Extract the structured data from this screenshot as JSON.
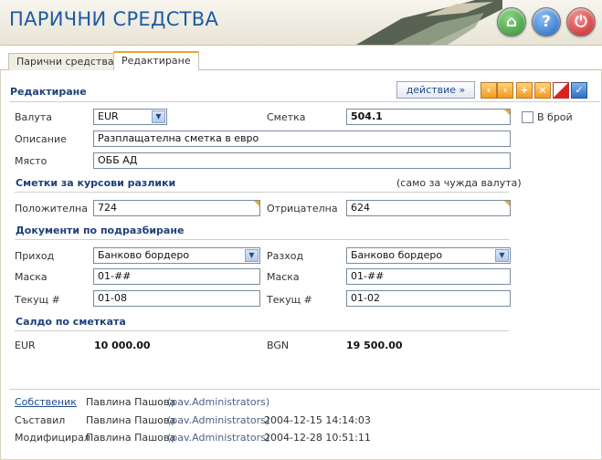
{
  "header": {
    "title": "ПАРИЧНИ СРЕДСТВА"
  },
  "tabs": [
    {
      "label": "Парични средства"
    },
    {
      "label": "Редактиране"
    }
  ],
  "form": {
    "section_title": "Редактиране",
    "action_label": "действие »",
    "currency_label": "Валута",
    "currency_value": "EUR",
    "account_label": "Сметка",
    "account_value": "504.1",
    "in_cash_label": "В брой",
    "description_label": "Описание",
    "description_value": "Разплащателна сметка в евро",
    "place_label": "Място",
    "place_value": "ОББ АД"
  },
  "rate_diff": {
    "title": "Сметки за курсови разлики",
    "note": "(само за чужда валута)",
    "positive_label": "Положителна",
    "positive_value": "724",
    "negative_label": "Отрицателна",
    "negative_value": "624"
  },
  "docs": {
    "title": "Документи по подразбиране",
    "income_label": "Приход",
    "income_value": "Банково бордеро",
    "expense_label": "Разход",
    "expense_value": "Банково бордеро",
    "mask_label": "Маска",
    "mask_income": "01-##",
    "mask_expense": "01-##",
    "current_label": "Текущ #",
    "current_income": "01-08",
    "current_expense": "01-02"
  },
  "balance": {
    "title": "Салдо по сметката",
    "cur1": "EUR",
    "val1": "10 000.00",
    "cur2": "BGN",
    "val2": "19 500.00"
  },
  "meta": {
    "owner_label": "Собственик",
    "owner_name": "Павлина Пашова",
    "owner_group": "(pav.Administrators)",
    "created_label": "Съставил",
    "created_name": "Павлина Пашова",
    "created_group": "(pav.Administrators)",
    "created_date": "2004-12-15 14:14:03",
    "modified_label": "Модифицирал",
    "modified_name": "Павлина Пашова",
    "modified_group": "(pav.Administrators)",
    "modified_date": "2004-12-28 10:51:11"
  }
}
